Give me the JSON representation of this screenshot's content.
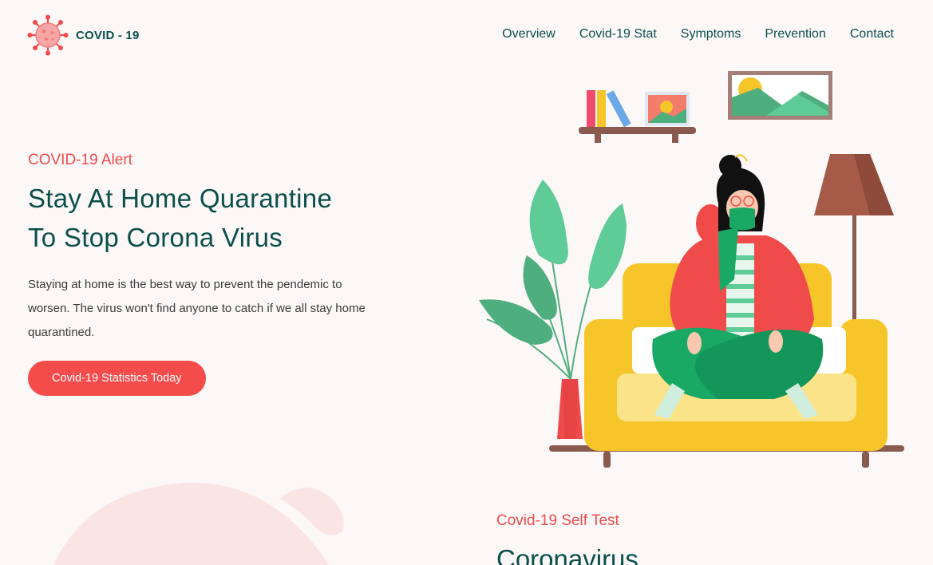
{
  "brand": {
    "name": "COVID - 19"
  },
  "nav": {
    "items": [
      {
        "label": "Overview"
      },
      {
        "label": "Covid-19 Stat"
      },
      {
        "label": "Symptoms"
      },
      {
        "label": "Prevention"
      },
      {
        "label": "Contact"
      }
    ]
  },
  "hero": {
    "eyebrow": "COVID-19 Alert",
    "title_line1": "Stay At Home Quarantine",
    "title_line2": "To Stop Corona Virus",
    "description": "Staying at home is the best way to prevent the pendemic to worsen. The virus won't find anyone to catch if we all stay home quarantined.",
    "cta_label": "Covid-19 Statistics Today"
  },
  "self_test": {
    "eyebrow": "Covid-19 Self Test",
    "title": "Coronavirus"
  },
  "colors": {
    "primary": "#0b4f4a",
    "accent": "#f44b4b",
    "background": "#fdf8f8"
  }
}
